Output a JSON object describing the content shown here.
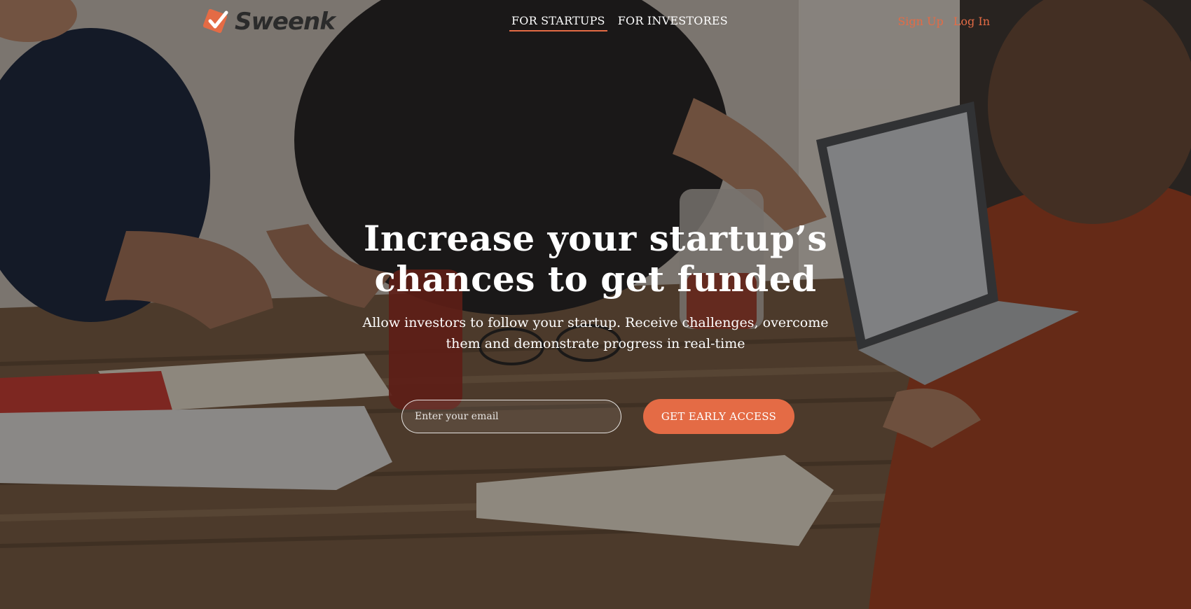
{
  "brand": {
    "name": "Sweenk",
    "logo_icon": "checkmark-square-icon",
    "accent_color": "#e46b45"
  },
  "nav": {
    "items": [
      {
        "label": "FOR STARTUPS",
        "active": true
      },
      {
        "label": "FOR INVESTORES",
        "active": false
      }
    ],
    "sign_up": "Sign Up",
    "log_in": "Log In"
  },
  "hero": {
    "title_line1": "Increase your startup’s",
    "title_line2": "chances to get funded",
    "subtitle_line1": "Allow investors to follow your startup. Receive challenges, overcome",
    "subtitle_line2": "them and demonstrate progress in real-time",
    "email_placeholder": "Enter your email",
    "email_value": "",
    "cta_label": "GET EARLY ACCESS"
  }
}
